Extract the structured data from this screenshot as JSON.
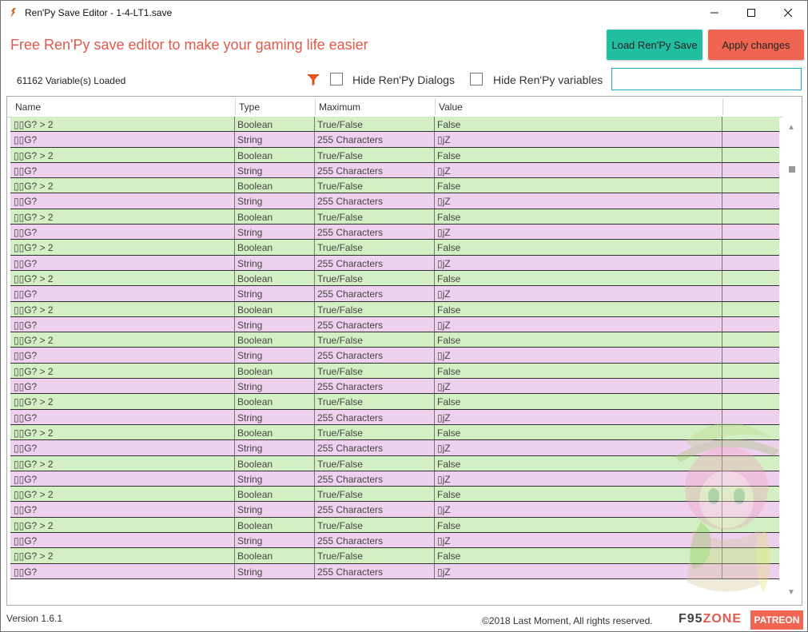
{
  "window": {
    "title": "Ren'Py Save Editor - 1-4-LT1.save",
    "minimize": "—",
    "maximize": "☐",
    "close": "✕"
  },
  "header": {
    "tagline": "Free Ren'Py save editor to make your gaming life easier",
    "load_button": "Load Ren'Py Save",
    "apply_button": "Apply changes"
  },
  "toolbar": {
    "loaded_text": "61162 Variable(s) Loaded",
    "hide_dialogs_label": "Hide Ren'Py Dialogs",
    "hide_variables_label": "Hide Ren'Py variables",
    "hide_dialogs_checked": false,
    "hide_variables_checked": false,
    "search_value": "",
    "filter_icon": "filter-icon"
  },
  "grid": {
    "columns": [
      "Name",
      "Type",
      "Maximum",
      "Value"
    ],
    "rows": [
      {
        "name": "▯▯G? > 2",
        "type": "Boolean",
        "max": "True/False",
        "value": "False",
        "kind": "bool"
      },
      {
        "name": "▯▯G?",
        "type": "String",
        "max": "255 Characters",
        "value": "▯jZ",
        "kind": "str"
      },
      {
        "name": "▯▯G? > 2",
        "type": "Boolean",
        "max": "True/False",
        "value": "False",
        "kind": "bool"
      },
      {
        "name": "▯▯G?",
        "type": "String",
        "max": "255 Characters",
        "value": "▯jZ",
        "kind": "str"
      },
      {
        "name": "▯▯G? > 2",
        "type": "Boolean",
        "max": "True/False",
        "value": "False",
        "kind": "bool"
      },
      {
        "name": "▯▯G?",
        "type": "String",
        "max": "255 Characters",
        "value": "▯jZ",
        "kind": "str"
      },
      {
        "name": "▯▯G? > 2",
        "type": "Boolean",
        "max": "True/False",
        "value": "False",
        "kind": "bool"
      },
      {
        "name": "▯▯G?",
        "type": "String",
        "max": "255 Characters",
        "value": "▯jZ",
        "kind": "str"
      },
      {
        "name": "▯▯G? > 2",
        "type": "Boolean",
        "max": "True/False",
        "value": "False",
        "kind": "bool"
      },
      {
        "name": "▯▯G?",
        "type": "String",
        "max": "255 Characters",
        "value": "▯jZ",
        "kind": "str"
      },
      {
        "name": "▯▯G? > 2",
        "type": "Boolean",
        "max": "True/False",
        "value": "False",
        "kind": "bool"
      },
      {
        "name": "▯▯G?",
        "type": "String",
        "max": "255 Characters",
        "value": "▯jZ",
        "kind": "str"
      },
      {
        "name": "▯▯G? > 2",
        "type": "Boolean",
        "max": "True/False",
        "value": "False",
        "kind": "bool"
      },
      {
        "name": "▯▯G?",
        "type": "String",
        "max": "255 Characters",
        "value": "▯jZ",
        "kind": "str"
      },
      {
        "name": "▯▯G? > 2",
        "type": "Boolean",
        "max": "True/False",
        "value": "False",
        "kind": "bool"
      },
      {
        "name": "▯▯G?",
        "type": "String",
        "max": "255 Characters",
        "value": "▯jZ",
        "kind": "str"
      },
      {
        "name": "▯▯G? > 2",
        "type": "Boolean",
        "max": "True/False",
        "value": "False",
        "kind": "bool"
      },
      {
        "name": "▯▯G?",
        "type": "String",
        "max": "255 Characters",
        "value": "▯jZ",
        "kind": "str"
      },
      {
        "name": "▯▯G? > 2",
        "type": "Boolean",
        "max": "True/False",
        "value": "False",
        "kind": "bool"
      },
      {
        "name": "▯▯G?",
        "type": "String",
        "max": "255 Characters",
        "value": "▯jZ",
        "kind": "str"
      },
      {
        "name": "▯▯G? > 2",
        "type": "Boolean",
        "max": "True/False",
        "value": "False",
        "kind": "bool"
      },
      {
        "name": "▯▯G?",
        "type": "String",
        "max": "255 Characters",
        "value": "▯jZ",
        "kind": "str"
      },
      {
        "name": "▯▯G? > 2",
        "type": "Boolean",
        "max": "True/False",
        "value": "False",
        "kind": "bool"
      },
      {
        "name": "▯▯G?",
        "type": "String",
        "max": "255 Characters",
        "value": "▯jZ",
        "kind": "str"
      },
      {
        "name": "▯▯G? > 2",
        "type": "Boolean",
        "max": "True/False",
        "value": "False",
        "kind": "bool"
      },
      {
        "name": "▯▯G?",
        "type": "String",
        "max": "255 Characters",
        "value": "▯jZ",
        "kind": "str"
      },
      {
        "name": "▯▯G? > 2",
        "type": "Boolean",
        "max": "True/False",
        "value": "False",
        "kind": "bool"
      },
      {
        "name": "▯▯G?",
        "type": "String",
        "max": "255 Characters",
        "value": "▯jZ",
        "kind": "str"
      },
      {
        "name": "▯▯G? > 2",
        "type": "Boolean",
        "max": "True/False",
        "value": "False",
        "kind": "bool"
      },
      {
        "name": "▯▯G?",
        "type": "String",
        "max": "255 Characters",
        "value": "▯jZ",
        "kind": "str"
      }
    ]
  },
  "footer": {
    "version": "Version 1.6.1",
    "copyright": "©2018 Last Moment, All rights reserved.",
    "f95_left": "F95",
    "f95_right": "ZONE",
    "patreon": "PATREON"
  },
  "colors": {
    "accent_text": "#e05a4b",
    "load_button": "#1fbfa0",
    "apply_button": "#f06452",
    "row_boolean": "#d3f0c4",
    "row_string": "#efd0ef",
    "search_border": "#1fa9c9"
  }
}
